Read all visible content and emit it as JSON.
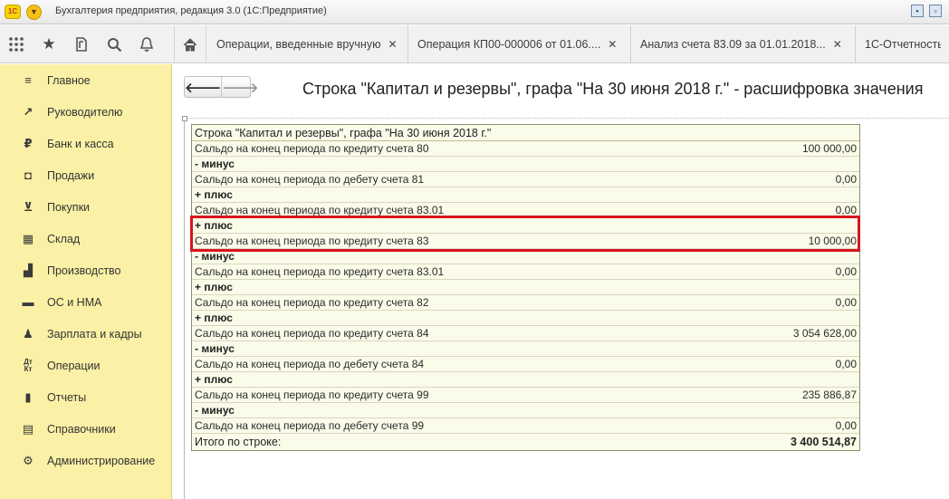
{
  "app": {
    "logo_text": "1С",
    "title": "Бухгалтерия предприятия, редакция 3.0  (1С:Предприятие)"
  },
  "toolbar_icons": [
    "apps-grid-icon",
    "star-icon",
    "history-icon",
    "search-icon",
    "bell-icon",
    "home-icon"
  ],
  "tabs": [
    {
      "label": "Операции, введенные вручную",
      "close": "✕"
    },
    {
      "label": "Операция КП00-000006 от 01.06....",
      "close": "✕"
    },
    {
      "label": "Анализ счета 83.09 за 01.01.2018...",
      "close": "✕"
    },
    {
      "label": "1С-Отчетность",
      "close": ""
    }
  ],
  "sidebar": {
    "items": [
      {
        "label": "Главное",
        "icon": "menu-lines-icon"
      },
      {
        "label": "Руководителю",
        "icon": "trend-icon"
      },
      {
        "label": "Банк и касса",
        "icon": "ruble-icon"
      },
      {
        "label": "Продажи",
        "icon": "bag-icon"
      },
      {
        "label": "Покупки",
        "icon": "cart-icon"
      },
      {
        "label": "Склад",
        "icon": "warehouse-icon"
      },
      {
        "label": "Производство",
        "icon": "factory-icon"
      },
      {
        "label": "ОС и НМА",
        "icon": "truck-icon"
      },
      {
        "label": "Зарплата и кадры",
        "icon": "person-icon"
      },
      {
        "label": "Операции",
        "icon": "dt-kt-icon"
      },
      {
        "label": "Отчеты",
        "icon": "bar-chart-icon"
      },
      {
        "label": "Справочники",
        "icon": "book-icon"
      },
      {
        "label": "Администрирование",
        "icon": "gear-icon"
      }
    ]
  },
  "page": {
    "title": "Строка \"Капитал и резервы\", графа \"На 30 июня 2018 г.\" - расшифровка значения",
    "back": "🡐",
    "forward": "🡒"
  },
  "report": {
    "header": "Строка \"Капитал и резервы\", графа \"На 30 июня 2018 г.\"",
    "rows": [
      {
        "text": "Сальдо на конец периода по кредиту счета 80",
        "value": "100 000,00",
        "kind": "line"
      },
      {
        "text": "- минус",
        "value": "",
        "kind": "op"
      },
      {
        "text": "Сальдо на конец периода по дебету счета 81",
        "value": "0,00",
        "kind": "line"
      },
      {
        "text": "+ плюс",
        "value": "",
        "kind": "op"
      },
      {
        "text": "Сальдо на конец периода по кредиту счета 83.01",
        "value": "0,00",
        "kind": "line"
      },
      {
        "text": "+ плюс",
        "value": "",
        "kind": "op"
      },
      {
        "text": "Сальдо на конец периода по кредиту счета 83",
        "value": "10 000,00",
        "kind": "line"
      },
      {
        "text": "- минус",
        "value": "",
        "kind": "op"
      },
      {
        "text": "Сальдо на конец периода по кредиту счета 83.01",
        "value": "0,00",
        "kind": "line"
      },
      {
        "text": "+ плюс",
        "value": "",
        "kind": "op"
      },
      {
        "text": "Сальдо на конец периода по кредиту счета 82",
        "value": "0,00",
        "kind": "line"
      },
      {
        "text": "+ плюс",
        "value": "",
        "kind": "op"
      },
      {
        "text": "Сальдо на конец периода по кредиту счета 84",
        "value": "3 054 628,00",
        "kind": "line"
      },
      {
        "text": "- минус",
        "value": "",
        "kind": "op"
      },
      {
        "text": "Сальдо на конец периода по дебету счета 84",
        "value": "0,00",
        "kind": "line"
      },
      {
        "text": "+ плюс",
        "value": "",
        "kind": "op"
      },
      {
        "text": "Сальдо на конец периода по кредиту счета 99",
        "value": "235 886,87",
        "kind": "line"
      },
      {
        "text": "- минус",
        "value": "",
        "kind": "op"
      },
      {
        "text": "Сальдо на конец периода по дебету счета 99",
        "value": "0,00",
        "kind": "line"
      }
    ],
    "total_label": "Итого по строке:",
    "total_value": "3 400 514,87"
  },
  "colors": {
    "sidebar_bg": "#fbf1a6",
    "report_bg": "#fbfbe9",
    "highlight": "#d9141e"
  }
}
